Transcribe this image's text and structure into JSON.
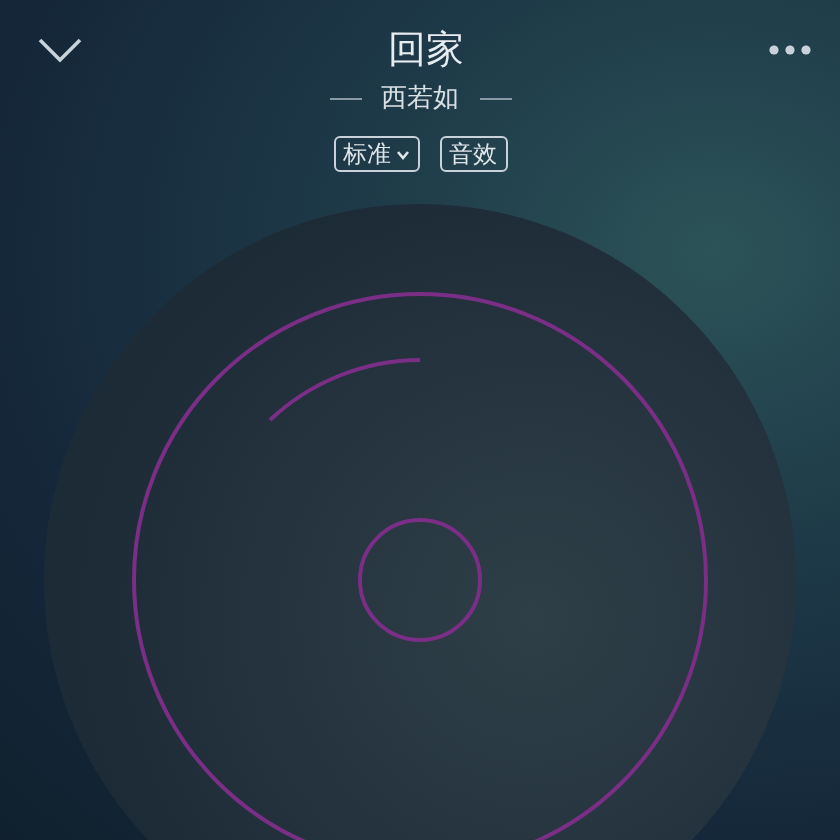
{
  "header": {
    "title": "回家",
    "artist": "西若如"
  },
  "tags": [
    {
      "label": "标准",
      "kind": "dropdown"
    },
    {
      "label": "音效",
      "kind": "plain"
    }
  ]
}
